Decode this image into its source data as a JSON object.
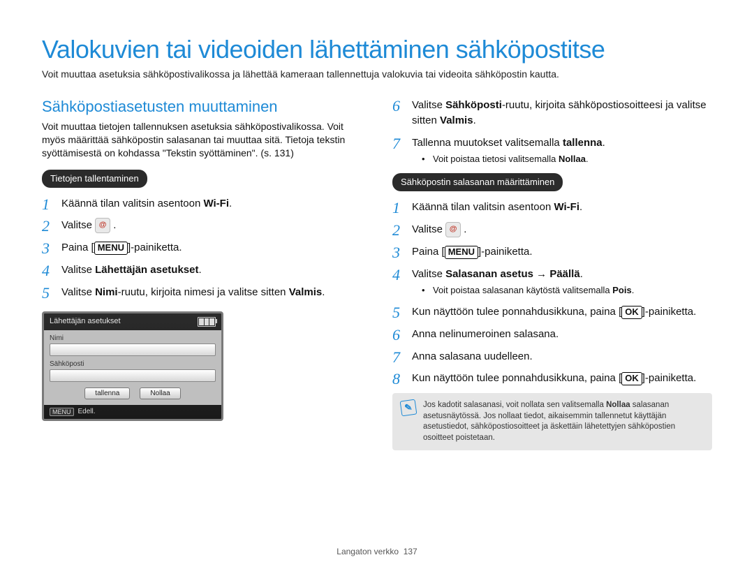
{
  "title": "Valokuvien tai videoiden lähettäminen sähköpostitse",
  "intro": "Voit muuttaa asetuksia sähköpostivalikossa ja lähettää kameraan tallennettuja valokuvia tai videoita sähköpostin kautta.",
  "left": {
    "heading": "Sähköpostiasetusten muuttaminen",
    "para": "Voit muuttaa tietojen tallennuksen asetuksia sähköpostivalikossa. Voit myös määrittää sähköpostin salasanan tai muuttaa sitä. Tietoja tekstin syöttämisestä on kohdassa \"Tekstin syöttäminen\". (s. 131)",
    "pill": "Tietojen tallentaminen",
    "s1_a": "Käännä tilan valitsin asentoon ",
    "s1_b": "Wi-Fi",
    "s1_c": ".",
    "s2": "Valitse ",
    "s3_a": "Paina [",
    "s3_b": "MENU",
    "s3_c": "]-painiketta.",
    "s4_a": "Valitse ",
    "s4_b": "Lähettäjän asetukset",
    "s4_c": ".",
    "s5_a": "Valitse ",
    "s5_b": "Nimi",
    "s5_c": "-ruutu, kirjoita nimesi ja valitse sitten ",
    "s5_d": "Valmis",
    "s5_e": "."
  },
  "device": {
    "title": "Lähettäjän asetukset",
    "name_label": "Nimi",
    "email_label": "Sähköposti",
    "btn_save": "tallenna",
    "btn_reset": "Nollaa",
    "menu": "MENU",
    "back": "Edell."
  },
  "right": {
    "s6_a": "Valitse ",
    "s6_b": "Sähköposti",
    "s6_c": "-ruutu, kirjoita sähköpostiosoitteesi ja valitse sitten ",
    "s6_d": "Valmis",
    "s6_e": ".",
    "s7_a": "Tallenna muutokset valitsemalla ",
    "s7_b": "tallenna",
    "s7_c": ".",
    "s7_sub_a": "Voit poistaa tietosi valitsemalla ",
    "s7_sub_b": "Nollaa",
    "s7_sub_c": ".",
    "pill": "Sähköpostin salasanan määrittäminen",
    "p1_a": "Käännä tilan valitsin asentoon ",
    "p1_b": "Wi-Fi",
    "p1_c": ".",
    "p2": "Valitse ",
    "p3_a": "Paina [",
    "p3_b": "MENU",
    "p3_c": "]-painiketta.",
    "p4_a": "Valitse ",
    "p4_b": "Salasanan asetus",
    "p4_arrow": " → ",
    "p4_c": "Päällä",
    "p4_d": ".",
    "p4_sub_a": "Voit poistaa salasanan käytöstä valitsemalla ",
    "p4_sub_b": "Pois",
    "p4_sub_c": ".",
    "p5_a": "Kun näyttöön tulee ponnahdusikkuna, paina [",
    "p5_b": "OK",
    "p5_c": "]-painiketta.",
    "p6": "Anna nelinumeroinen salasana.",
    "p7": "Anna salasana uudelleen.",
    "p8_a": "Kun näyttöön tulee ponnahdusikkuna, paina [",
    "p8_b": "OK",
    "p8_c": "]-painiketta.",
    "tip_a": "Jos kadotit salasanasi, voit nollata sen valitsemalla ",
    "tip_b": "Nollaa",
    "tip_c": " salasanan asetusnäytössä. Jos nollaat tiedot, aikaisemmin tallennetut käyttäjän asetustiedot, sähköpostiosoitteet ja äskettäin lähetettyjen sähköpostien osoitteet poistetaan."
  },
  "footer": {
    "section": "Langaton verkko",
    "page": "137"
  }
}
